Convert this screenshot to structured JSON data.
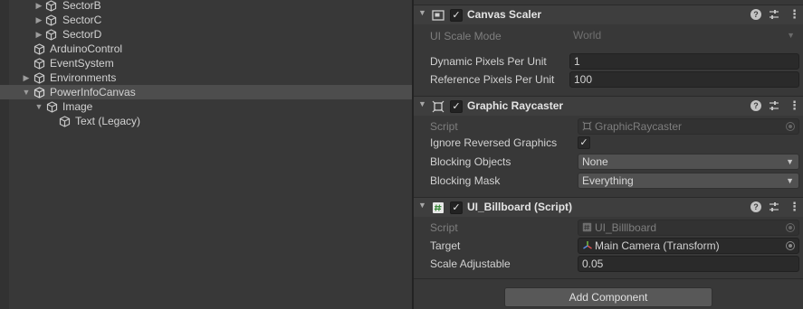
{
  "hierarchy": {
    "items": [
      {
        "label": "SectorB",
        "icon": "gameobject-cube-icon",
        "expanded": false
      },
      {
        "label": "SectorC",
        "icon": "gameobject-cube-icon",
        "expanded": false
      },
      {
        "label": "SectorD",
        "icon": "gameobject-cube-icon",
        "expanded": false
      },
      {
        "label": "ArduinoControl",
        "icon": "gameobject-cube-icon"
      },
      {
        "label": "EventSystem",
        "icon": "gameobject-cube-icon"
      },
      {
        "label": "Environments",
        "icon": "gameobject-cube-icon",
        "expanded": false
      },
      {
        "label": "PowerInfoCanvas",
        "icon": "gameobject-cube-icon",
        "expanded": true,
        "selected": true
      },
      {
        "label": "Image",
        "icon": "gameobject-cube-icon",
        "expanded": true
      },
      {
        "label": "Text (Legacy)",
        "icon": "gameobject-cube-icon"
      }
    ]
  },
  "inspector": {
    "canvas_scaler": {
      "title": "Canvas Scaler",
      "enabled": true,
      "ui_scale_mode_label": "UI Scale Mode",
      "ui_scale_mode_value": "World",
      "dynamic_pixels_label": "Dynamic Pixels Per Unit",
      "dynamic_pixels_value": "1",
      "reference_pixels_label": "Reference Pixels Per Unit",
      "reference_pixels_value": "100"
    },
    "graphic_raycaster": {
      "title": "Graphic Raycaster",
      "enabled": true,
      "script_label": "Script",
      "script_value": "GraphicRaycaster",
      "ignore_reversed_label": "Ignore Reversed Graphics",
      "ignore_reversed_checked": true,
      "blocking_objects_label": "Blocking Objects",
      "blocking_objects_value": "None",
      "blocking_mask_label": "Blocking Mask",
      "blocking_mask_value": "Everything"
    },
    "ui_billboard": {
      "title": "UI_Billboard (Script)",
      "enabled": true,
      "script_label": "Script",
      "script_value": "UI_Billlboard",
      "target_label": "Target",
      "target_value": "Main Camera (Transform)",
      "scale_adjustable_label": "Scale Adjustable",
      "scale_adjustable_value": "0.05"
    },
    "add_component_label": "Add Component"
  },
  "glyphs": {
    "fold_collapsed": "▶",
    "fold_expanded": "▼",
    "checkmark": "✓",
    "help": "?",
    "kebab": "⋮",
    "dropdown_arrow": "▼"
  },
  "colors": {
    "background": "#383838",
    "selected_row": "#4d4d4d",
    "component_header": "#3e3e3e",
    "field_bg": "#2a2a2a",
    "button_bg": "#585858"
  }
}
